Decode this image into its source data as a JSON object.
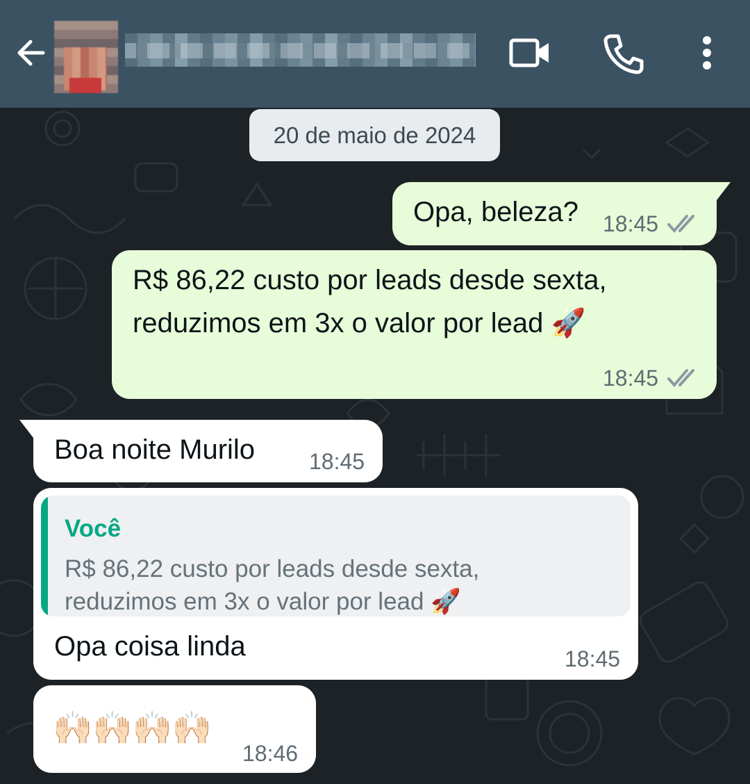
{
  "header": {
    "back_icon": "arrow-left-icon",
    "contact_name_blurred": true,
    "actions": [
      "video-call-icon",
      "phone-icon",
      "more-vert-icon"
    ],
    "background": "#3b5262"
  },
  "chat": {
    "date": "20 de maio de 2024",
    "messages": [
      {
        "direction": "outgoing",
        "text": "Opa, beleza?",
        "time": "18:45",
        "status": "read-ticks"
      },
      {
        "direction": "outgoing",
        "line1": "R$ 86,22 custo por leads desde sexta,",
        "line2": "reduzimos em 3x o valor por lead 🚀",
        "time": "18:45",
        "status": "read-ticks"
      },
      {
        "direction": "incoming",
        "text": "Boa noite Murilo",
        "time": "18:45"
      },
      {
        "direction": "incoming",
        "quote": {
          "author": "Você",
          "line1": "R$ 86,22 custo por leads desde sexta,",
          "line2": "reduzimos em 3x o valor por lead 🚀"
        },
        "text": "Opa coisa linda",
        "time": "18:45"
      },
      {
        "direction": "incoming",
        "text": "🙌🏻🙌🏻🙌🏻🙌🏻",
        "time": "18:46"
      }
    ]
  },
  "colors": {
    "outgoing_bubble": "#e7fcd9",
    "incoming_bubble": "#ffffff",
    "quote_accent": "#06a884",
    "wallpaper": "#1d2226"
  }
}
